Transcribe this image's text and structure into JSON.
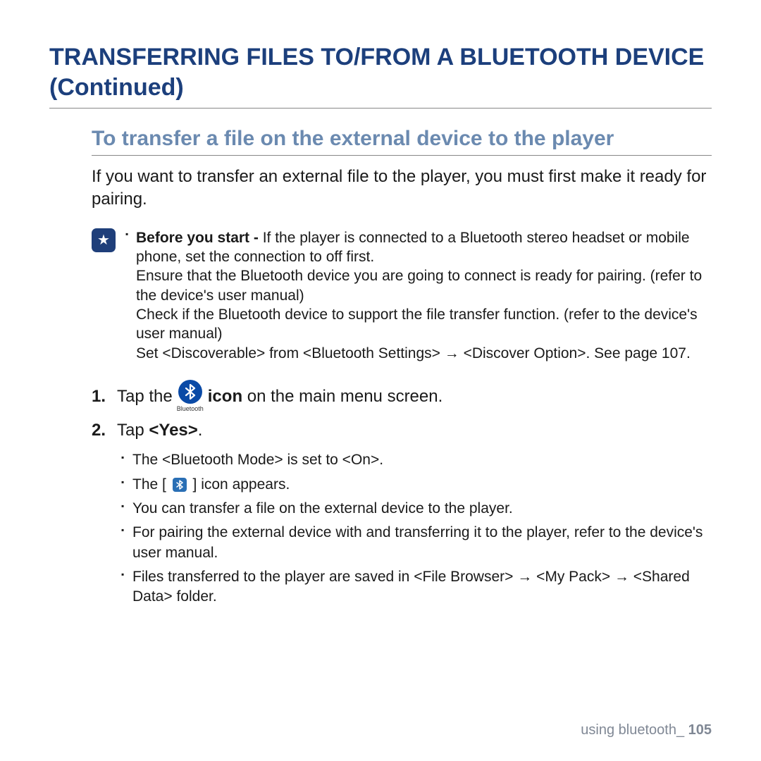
{
  "title": "TRANSFERRING FILES TO/FROM A BLUETOOTH DEVICE (Continued)",
  "subtitle": "To transfer a file on the external device to the player",
  "intro": "If you want to transfer an external file to the player, you must first make it ready for pairing.",
  "note": {
    "before_label": "Before you start - ",
    "before_text": "If the player is connected to a Bluetooth stereo headset or mobile phone, set the connection to off first.",
    "line2": "Ensure that the Bluetooth device you are going to connect is ready for pairing. (refer to the device's user manual)",
    "line3": "Check if the Bluetooth device to support the file transfer function. (refer to the device's user manual)",
    "line4": "Set <Discoverable> from <Bluetooth Settings> → <Discover Option>. See page 107."
  },
  "steps": {
    "s1_num": "1.",
    "s1_pre": "Tap the",
    "s1_icon_caption": "Bluetooth",
    "s1_post_bold": "icon",
    "s1_post_rest": " on the main menu screen.",
    "s2_num": "2.",
    "s2_pre": "Tap ",
    "s2_bold": "<Yes>",
    "s2_post": "."
  },
  "sublist": {
    "a": "The <Bluetooth Mode> is set to <On>.",
    "b_pre": "The [ ",
    "b_post": " ] icon appears.",
    "c": "You can transfer a file on the external device to the player.",
    "d": "For pairing the external device with and transferring it to the player, refer to the device's user manual.",
    "e": "Files transferred to the player are saved in <File Browser> → <My Pack> → <Shared Data> folder."
  },
  "footer": {
    "text": "using bluetooth_ ",
    "page": "105"
  },
  "glyphs": {
    "bluetooth": "⋮⋮",
    "star": "★"
  }
}
